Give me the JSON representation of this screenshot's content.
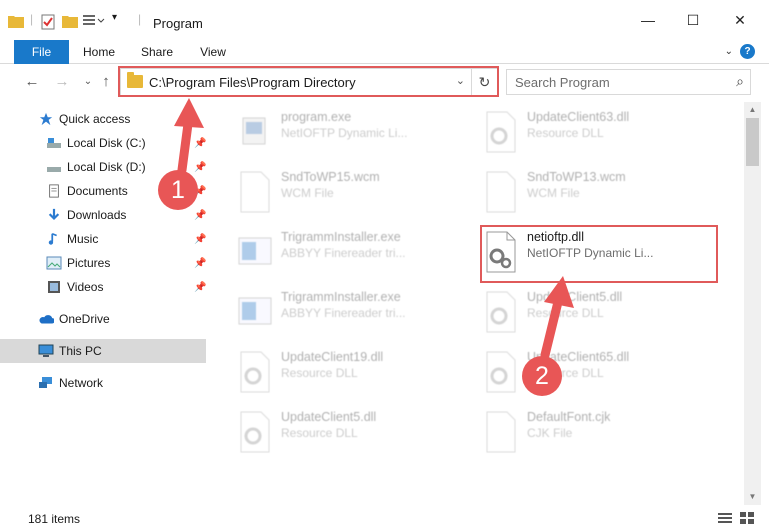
{
  "window": {
    "title": "Program",
    "minimize": "—",
    "maximize": "☐",
    "close": "✕"
  },
  "ribbon": {
    "tabs": [
      "File",
      "Home",
      "Share",
      "View"
    ],
    "help": "?"
  },
  "address": {
    "path": "C:\\Program Files\\Program Directory",
    "search_placeholder": "Search Program"
  },
  "nav": {
    "items": [
      {
        "label": "Quick access",
        "icon": "star-icon"
      },
      {
        "label": "Local Disk (C:)",
        "icon": "drive-icon",
        "pinned": true
      },
      {
        "label": "Local Disk (D:)",
        "icon": "drive-icon",
        "pinned": true
      },
      {
        "label": "Documents",
        "icon": "documents-icon",
        "pinned": true
      },
      {
        "label": "Downloads",
        "icon": "downloads-icon",
        "pinned": true
      },
      {
        "label": "Music",
        "icon": "music-icon",
        "pinned": true
      },
      {
        "label": "Pictures",
        "icon": "pictures-icon",
        "pinned": true
      },
      {
        "label": "Videos",
        "icon": "videos-icon",
        "pinned": true
      },
      {
        "label": "OneDrive",
        "icon": "onedrive-icon"
      },
      {
        "label": "This PC",
        "icon": "pc-icon",
        "selected": true
      },
      {
        "label": "Network",
        "icon": "network-icon"
      }
    ]
  },
  "files": [
    {
      "name": "program.exe",
      "type": "NetIOFTP Dynamic Li...",
      "icon": "exe-icon"
    },
    {
      "name": "UpdateClient63.dll",
      "type": "Resource DLL",
      "icon": "dll-icon"
    },
    {
      "name": "SndToWP15.wcm",
      "type": "WCM File",
      "icon": "blank-file-icon"
    },
    {
      "name": "SndToWP13.wcm",
      "type": "WCM File",
      "icon": "blank-file-icon"
    },
    {
      "name": "TrigrammInstaller.exe",
      "type": "ABBYY Finereader tri...",
      "icon": "installer-icon"
    },
    {
      "name": "netioftp.dll",
      "type": "NetIOFTP Dynamic Li...",
      "icon": "dll-icon",
      "highlighted": true
    },
    {
      "name": "TrigrammInstaller.exe",
      "type": "ABBYY Finereader tri...",
      "icon": "installer-icon"
    },
    {
      "name": "UpdateClient5.dll",
      "type": "Resource DLL",
      "icon": "dll-icon"
    },
    {
      "name": "UpdateClient19.dll",
      "type": "Resource DLL",
      "icon": "dll-icon"
    },
    {
      "name": "UpdateClient65.dll",
      "type": "Resource DLL",
      "icon": "dll-icon"
    },
    {
      "name": "UpdateClient5.dll",
      "type": "Resource DLL",
      "icon": "dll-icon"
    },
    {
      "name": "DefaultFont.cjk",
      "type": "CJK File",
      "icon": "blank-file-icon"
    }
  ],
  "status": {
    "item_count": "181 items"
  },
  "annotations": {
    "step1": "1",
    "step2": "2",
    "color": "#e05a5a"
  }
}
